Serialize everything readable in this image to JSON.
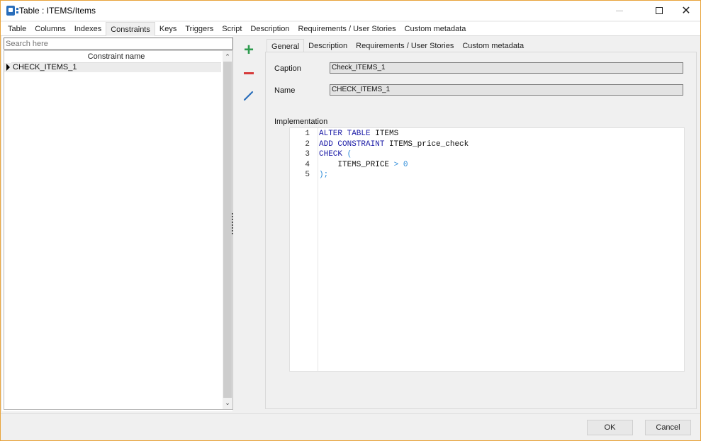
{
  "window": {
    "title": "Table : ITEMS/Items",
    "controls": {
      "minimize": "minimize",
      "maximize": "maximize",
      "close": "✕"
    }
  },
  "main_tabs": [
    {
      "label": "Table",
      "active": false
    },
    {
      "label": "Columns",
      "active": false
    },
    {
      "label": "Indexes",
      "active": false
    },
    {
      "label": "Constraints",
      "active": true
    },
    {
      "label": "Keys",
      "active": false
    },
    {
      "label": "Triggers",
      "active": false
    },
    {
      "label": "Script",
      "active": false
    },
    {
      "label": "Description",
      "active": false
    },
    {
      "label": "Requirements / User Stories",
      "active": false
    },
    {
      "label": "Custom metadata",
      "active": false
    }
  ],
  "left": {
    "search_placeholder": "Search here",
    "grid_header": "Constraint name",
    "rows": [
      {
        "name": "CHECK_ITEMS_1",
        "selected": true
      }
    ],
    "scroll_up": "⌃",
    "scroll_down": "⌄"
  },
  "toolbar": {
    "add": "+",
    "remove": "remove",
    "edit": "edit"
  },
  "sub_tabs": [
    {
      "label": "General",
      "active": true
    },
    {
      "label": "Description",
      "active": false
    },
    {
      "label": "Requirements / User Stories",
      "active": false
    },
    {
      "label": "Custom metadata",
      "active": false
    }
  ],
  "general": {
    "caption_label": "Caption",
    "caption_value": "Check_ITEMS_1",
    "name_label": "Name",
    "name_value": "CHECK_ITEMS_1",
    "implementation_label": "Implementation"
  },
  "code_lines": [
    {
      "n": "1",
      "tokens": [
        {
          "t": "ALTER TABLE ",
          "c": "kw"
        },
        {
          "t": "ITEMS",
          "c": "id"
        }
      ]
    },
    {
      "n": "2",
      "tokens": [
        {
          "t": "ADD CONSTRAINT ",
          "c": "kw"
        },
        {
          "t": "ITEMS_price_check",
          "c": "id"
        }
      ]
    },
    {
      "n": "3",
      "tokens": [
        {
          "t": "CHECK ",
          "c": "kw"
        },
        {
          "t": "(",
          "c": "op"
        }
      ]
    },
    {
      "n": "4",
      "tokens": [
        {
          "t": "    ITEMS_PRICE ",
          "c": "id"
        },
        {
          "t": "> 0",
          "c": "op"
        }
      ]
    },
    {
      "n": "5",
      "tokens": [
        {
          "t": ");",
          "c": "op"
        }
      ]
    }
  ],
  "buttons": {
    "ok": "OK",
    "cancel": "Cancel"
  }
}
